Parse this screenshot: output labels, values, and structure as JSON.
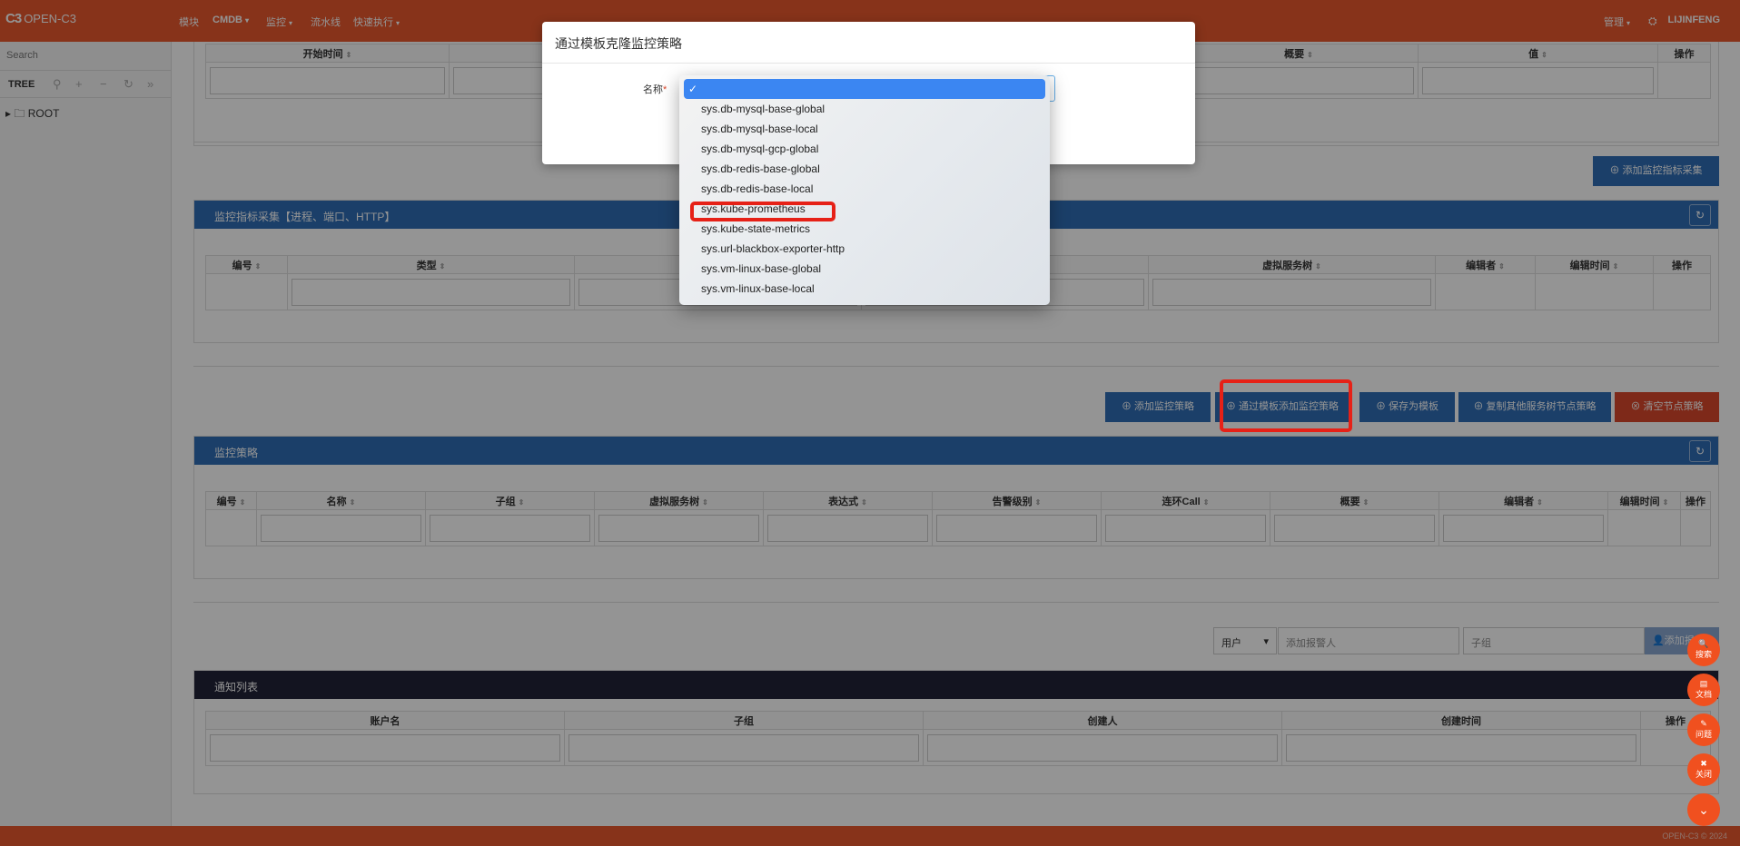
{
  "nav": {
    "logo": "OPEN-C3",
    "items": [
      "模块",
      "CMDB",
      "监控",
      "流水线",
      "快速执行"
    ],
    "admin": "管理",
    "user": "LIJINFENG"
  },
  "sidebar": {
    "search_placeholder": "Search",
    "tree_label": "TREE",
    "root": "ROOT"
  },
  "top_table": {
    "headers": [
      "开始时间",
      "概要",
      "值",
      "操作"
    ]
  },
  "metrics_panel": {
    "add_button": "添加监控指标采集",
    "title": "监控指标采集【进程、端口、HTTP】",
    "headers": [
      "编号",
      "类型",
      "虚拟服务树",
      "编辑者",
      "编辑时间",
      "操作"
    ]
  },
  "strategy_buttons": {
    "add": "添加监控策略",
    "template": "通过模板添加监控策略",
    "save_template": "保存为模板",
    "copy": "复制其他服务树节点策略",
    "clear": "清空节点策略"
  },
  "strategy_panel": {
    "title": "监控策略",
    "headers": [
      "编号",
      "名称",
      "子组",
      "虚拟服务树",
      "表达式",
      "告警级别",
      "连环Call",
      "概要",
      "编辑者",
      "编辑时间",
      "操作"
    ]
  },
  "notify_controls": {
    "select_value": "用户",
    "add_placeholder": "添加报警人",
    "group_placeholder": "子组",
    "add_button": "添加报"
  },
  "notify_panel": {
    "title": "通知列表",
    "headers": [
      "账户名",
      "子组",
      "创建人",
      "创建时间",
      "操作"
    ]
  },
  "fabs": [
    "搜索",
    "文档",
    "问题",
    "关闭"
  ],
  "footer": "OPEN-C3 © 2024",
  "modal": {
    "title": "通过模板克隆监控策略",
    "label": "名称",
    "required_mark": "*"
  },
  "dropdown": {
    "options": [
      "",
      "sys.db-mysql-base-global",
      "sys.db-mysql-base-local",
      "sys.db-mysql-gcp-global",
      "sys.db-redis-base-global",
      "sys.db-redis-base-local",
      "sys.kube-prometheus",
      "sys.kube-state-metrics",
      "sys.url-blackbox-exporter-http",
      "sys.vm-linux-base-global",
      "sys.vm-linux-base-local"
    ],
    "selected_index": 0,
    "highlighted_option": "sys.kube-prometheus"
  },
  "colors": {
    "nav": "#e8582e",
    "panel_header": "#2f6db5",
    "panel_header_dark": "#222437",
    "danger": "#d9472b",
    "highlight_box": "#e62117",
    "dropdown_selected": "#3b86f2"
  }
}
